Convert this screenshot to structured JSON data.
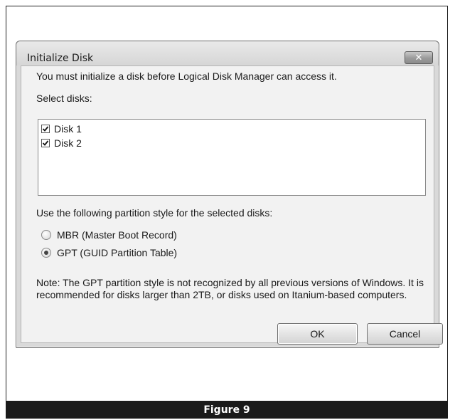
{
  "dialog": {
    "title": "Initialize Disk",
    "close_icon": "close-icon",
    "message": "You must initialize a disk before Logical Disk Manager can access it.",
    "select_label": "Select disks:",
    "disks": [
      {
        "label": "Disk 1",
        "checked": true
      },
      {
        "label": "Disk 2",
        "checked": true
      }
    ],
    "partition_label": "Use the following partition style for the selected disks:",
    "options": [
      {
        "label": "MBR (Master Boot Record)",
        "selected": false
      },
      {
        "label": "GPT (GUID Partition Table)",
        "selected": true
      }
    ],
    "note": "Note: The GPT partition style is not recognized by all previous versions of Windows. It is recommended for disks larger than 2TB, or disks used on Itanium-based computers.",
    "ok_label": "OK",
    "cancel_label": "Cancel"
  },
  "figure": {
    "caption": "Figure 9"
  },
  "colors": {
    "caption_bg": "#1a1a1a",
    "dialog_bg": "#f2f2f2",
    "close_button": "#9a9a9a"
  }
}
